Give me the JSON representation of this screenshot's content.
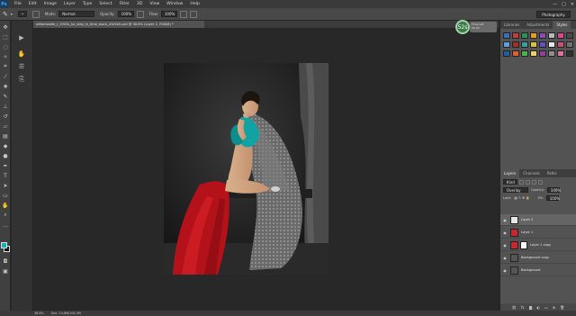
{
  "app": {
    "logo": "Ps"
  },
  "menu": [
    "File",
    "Edit",
    "Image",
    "Layer",
    "Type",
    "Select",
    "Filter",
    "3D",
    "View",
    "Window",
    "Help"
  ],
  "window_controls": [
    "—",
    "□",
    "✕"
  ],
  "options": {
    "mode_label": "Mode:",
    "mode_value": "Normal",
    "opacity_label": "Opacity:",
    "opacity_value": "100%",
    "flow_label": "Flow:",
    "flow_value": "100%",
    "workspace": "Photography"
  },
  "document": {
    "tab_title": "wiliamsadie_r_1920s_bz_step_in_time_stock_d3z5k0.psd @ 38.8% (Layer 2, RGB/8) *"
  },
  "timer": {
    "value": "52s",
    "line1": "Time left",
    "line2": "00:00"
  },
  "panels": {
    "top_tabs": [
      "Libraries",
      "Adjustments",
      "Styles"
    ],
    "active_top_tab": "Styles",
    "style_colors": [
      "#3b6fb0",
      "#c43c3c",
      "#2e8f5a",
      "#e0a020",
      "#8a4db0",
      "#b8b8b8",
      "#d44a8a",
      "#4a4a4a",
      "#5fa0d8",
      "#a03030",
      "#3e9e9e",
      "#d8c040",
      "#6050c0",
      "#e8e8e8",
      "#c85070",
      "#707070",
      "#2060a0",
      "#e06030",
      "#50b050",
      "#f0d060",
      "#9040a0",
      "#909090",
      "#e070a0",
      "#303030"
    ]
  },
  "layers_panel": {
    "tabs": [
      "Layers",
      "Channels",
      "Paths"
    ],
    "active_tab": "Layers",
    "kind_label": "Kind",
    "blend": "Overlay",
    "opacity_label": "Opacity:",
    "opacity_value": "100%",
    "lock_label": "Lock:",
    "fill_label": "Fill:",
    "fill_value": "100%",
    "layers": [
      {
        "name": "Layer 2",
        "selected": true,
        "thumb": "#e6e6e6",
        "mask": false
      },
      {
        "name": "Layer 1",
        "selected": false,
        "thumb": "#c8282d",
        "mask": false
      },
      {
        "name": "Layer 1 copy",
        "selected": false,
        "thumb": "#c8282d",
        "mask": true
      },
      {
        "name": "Background copy",
        "selected": false,
        "thumb": "#555555",
        "mask": false
      },
      {
        "name": "Background",
        "selected": false,
        "thumb": "#555555",
        "mask": false
      }
    ]
  },
  "status": {
    "zoom": "38.8%",
    "doc": "Doc: 14.8M/104.3M"
  }
}
